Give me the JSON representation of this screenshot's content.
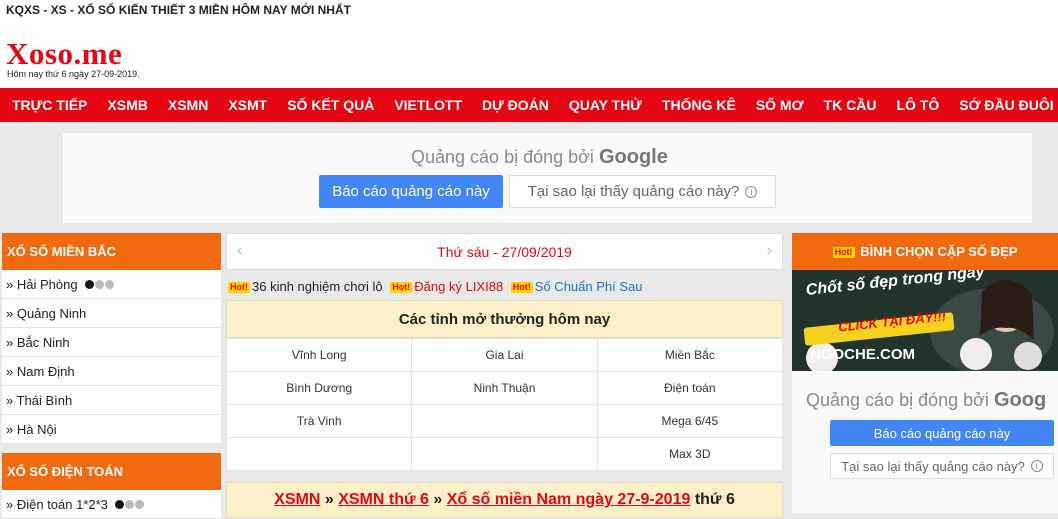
{
  "topbar": {
    "text": "KQXS - XS - XỔ SỐ KIẾN THIẾT 3 MIỀN HÔM NAY MỚI NHẤT"
  },
  "header": {
    "logo": "Xoso.me",
    "date": "Hôm nay thứ 6 ngày 27-09-2019."
  },
  "nav": [
    "TRỰC TIẾP",
    "XSMB",
    "XSMN",
    "XSMT",
    "SỐ KẾT QUẢ",
    "VIETLOTT",
    "DỰ ĐOÁN",
    "QUAY THỬ",
    "THỐNG KÊ",
    "SỐ MƠ",
    "TK CẦU",
    "LÔ TÔ",
    "SỚ ĐẦU ĐUÔI"
  ],
  "ad_top": {
    "blocked_prefix": "Quảng cáo bị đóng bởi",
    "brand": "Google",
    "report_button": "Báo cáo quảng cáo này",
    "why_button": "Tại sao lại thấy quảng cáo này?",
    "info": "i"
  },
  "sidebar_left": {
    "north_title": "XỔ SỐ MIỀN BẮC",
    "north_items": [
      "» Hải Phòng",
      "» Quảng Ninh",
      "» Bắc Ninh",
      "» Nam Định",
      "» Thái Bình",
      "» Hà Nội"
    ],
    "computer_title": "XỔ SỐ ĐIỆN TOÁN",
    "computer_items": [
      "» Điện toán 1*2*3"
    ]
  },
  "main": {
    "prev_arrow": "‹",
    "next_arrow": "›",
    "date_title": "Thứ sáu - 27/09/2019",
    "hot_badge": "Hot!",
    "hot_links": [
      "36 kinh nghiệm chơi lô",
      "Đăng ký LIXI88",
      "Số Chuẩn Phí Sau"
    ],
    "provinces_title": "Các tỉnh mở thưởng hôm nay",
    "provinces": [
      [
        "Vĩnh Long",
        "Gia Lai",
        "Miền Bắc"
      ],
      [
        "Bình Dương",
        "Ninh Thuận",
        "Điện toán"
      ],
      [
        "Trà Vinh",
        "",
        "Mega 6/45"
      ],
      [
        "",
        "",
        "Max 3D"
      ]
    ],
    "xsmn_link": "XSMN",
    "sep": "»",
    "xsmn_day": "XSMN thứ 6",
    "xsmn_full": "Xổ số miền Nam ngày 27-9-2019",
    "xsmn_suffix": "thứ 6"
  },
  "sidebar_right": {
    "title": "BÌNH CHỌN CẶP SỐ ĐẸP",
    "banner": {
      "line1": "Chốt số đẹp trong ngày",
      "line2": "CLICK TẠI ĐÂY!!!",
      "brand": "NGOCHE.COM"
    },
    "ad": {
      "blocked_prefix": "Quảng cáo bị đóng bởi",
      "brand": "Goog",
      "report_button": "Báo cáo quảng cáo này",
      "why_button": "Tại sao lại thấy quảng cáo này?",
      "info": "i"
    }
  },
  "colors": {
    "brand_red": "#e40613",
    "orange": "#f26a10",
    "google_blue": "#4285f4"
  }
}
